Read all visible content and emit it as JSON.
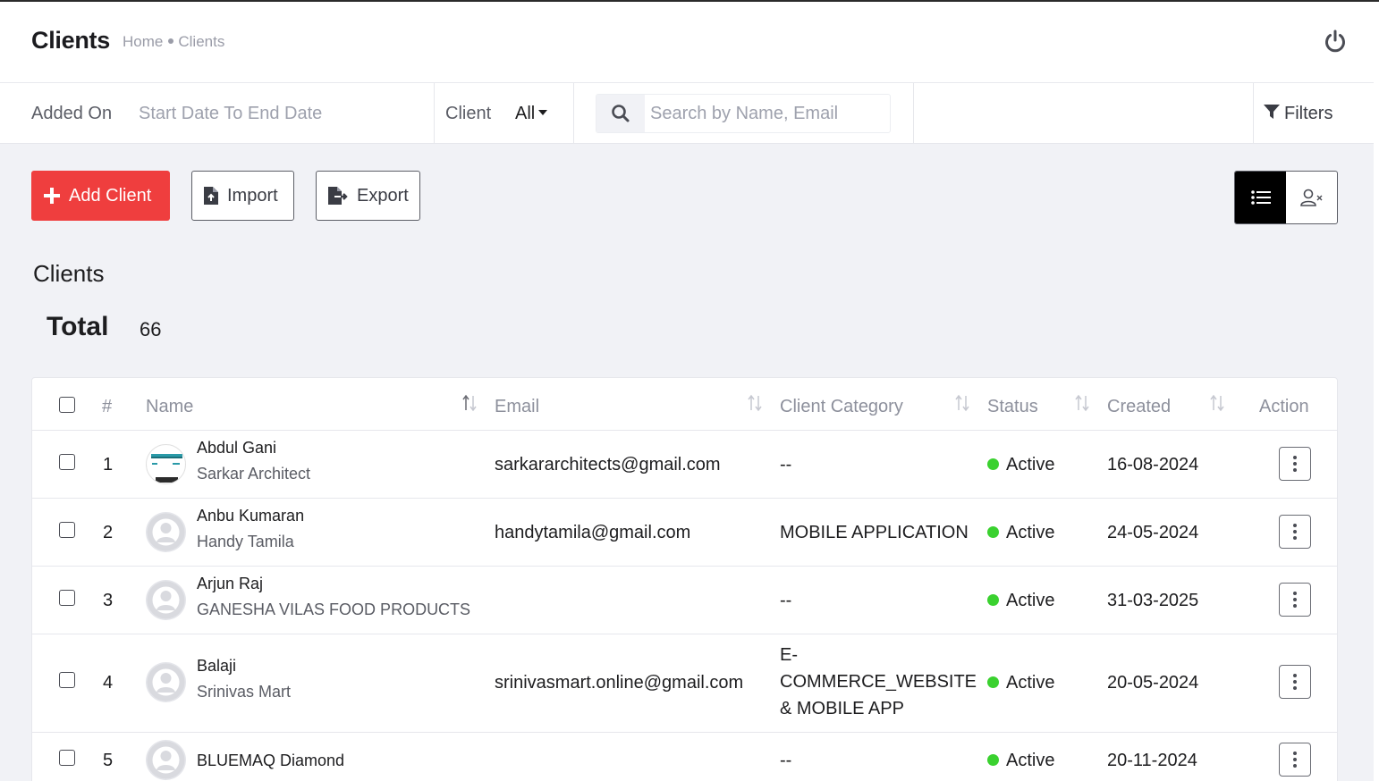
{
  "header": {
    "title": "Clients",
    "breadcrumb": {
      "home": "Home",
      "current": "Clients"
    }
  },
  "filterbar": {
    "added_on_label": "Added On",
    "date_placeholder": "Start Date To End Date",
    "client_label": "Client",
    "client_value": "All",
    "search_placeholder": "Search by Name, Email",
    "filters_label": "Filters"
  },
  "actions": {
    "add_label": "Add Client",
    "import_label": "Import",
    "export_label": "Export"
  },
  "section": {
    "title": "Clients",
    "total_label": "Total",
    "total_value": "66"
  },
  "table": {
    "headers": {
      "num": "#",
      "name": "Name",
      "email": "Email",
      "category": "Client Category",
      "status": "Status",
      "created": "Created",
      "action": "Action"
    },
    "rows": [
      {
        "num": "1",
        "name": "Abdul Gani",
        "company": "Sarkar Architect",
        "email": "sarkararchitects@gmail.com",
        "category": "--",
        "status": "Active",
        "created": "16-08-2024",
        "avatar": "company-logo"
      },
      {
        "num": "2",
        "name": "Anbu Kumaran",
        "company": "Handy Tamila",
        "email": "handytamila@gmail.com",
        "category": "MOBILE APPLICATION",
        "status": "Active",
        "created": "24-05-2024",
        "avatar": "user-placeholder"
      },
      {
        "num": "3",
        "name": "Arjun Raj",
        "company": "GANESHA VILAS FOOD PRODUCTS",
        "email": "",
        "category": "--",
        "status": "Active",
        "created": "31-03-2025",
        "avatar": "user-placeholder"
      },
      {
        "num": "4",
        "name": "Balaji",
        "company": "Srinivas Mart",
        "email": "srinivasmart.online@gmail.com",
        "category_lines": [
          "E-",
          "COMMERCE_WEBSITE",
          "& MOBILE APP"
        ],
        "status": "Active",
        "created": "20-05-2024",
        "avatar": "user-placeholder"
      },
      {
        "num": "5",
        "name": "BLUEMAQ Diamond",
        "company": "",
        "email": "",
        "category": "--",
        "status": "Active",
        "created": "20-11-2024",
        "avatar": "user-placeholder"
      }
    ]
  },
  "colors": {
    "primary_red": "#ef3e3e",
    "status_green": "#3ad12f",
    "background": "#f1f2f6"
  },
  "icons": [
    "power-icon",
    "search-icon",
    "filter-icon",
    "plus-icon",
    "file-import-icon",
    "file-export-icon",
    "list-icon",
    "user-remove-icon",
    "sort-icon",
    "kebab-icon",
    "user-avatar-icon"
  ]
}
